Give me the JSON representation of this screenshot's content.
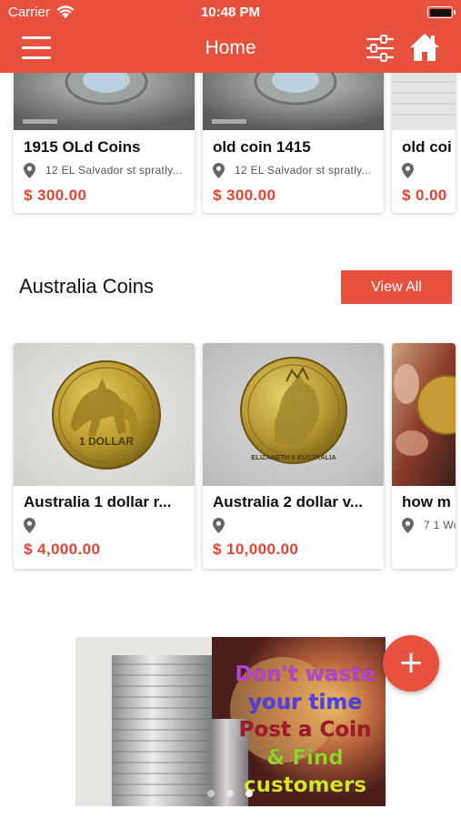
{
  "status_bar": {
    "carrier": "Carrier",
    "time": "10:48 PM"
  },
  "nav": {
    "title": "Home",
    "menu_icon": "hamburger-menu-icon",
    "filter_icon": "filter-sliders-icon",
    "home_icon": "home-icon"
  },
  "colors": {
    "accent": "#e9513f",
    "price": "#e24433"
  },
  "top_row": [
    {
      "title": "1915 OLd Coins",
      "location": "12 EL Salvador st spratly...",
      "price": "$ 300.00"
    },
    {
      "title": "old coin 1415",
      "location": "12 EL Salvador st spratly...",
      "price": "$ 300.00"
    },
    {
      "title": "old coi",
      "location": "",
      "price": "$ 0.00"
    }
  ],
  "australia": {
    "title": "Australia Coins",
    "view_all": "View All",
    "items": [
      {
        "title": "Australia 1 dollar r...",
        "location": "",
        "price": "$ 4,000.00",
        "coin_text": "1 DOLLAR"
      },
      {
        "title": "Australia 2 dollar v...",
        "location": "",
        "price": "$ 10,000.00",
        "coin_text": "ELIZABETH II AUSTRALIA"
      },
      {
        "title": "how m",
        "location": "7 1 Wo",
        "price": ""
      }
    ]
  },
  "banner": {
    "lines": [
      {
        "text": "Don't waste",
        "color": "#b844d6"
      },
      {
        "text": "your time",
        "color": "#4b3ff0"
      },
      {
        "text": "Post a Coin",
        "color": "#a01a28"
      },
      {
        "text": "& Find",
        "color": "#8fd62e"
      },
      {
        "text": "customers",
        "color": "#d4e82a"
      }
    ],
    "active_dot": 2
  },
  "fab": {
    "label": "+"
  }
}
